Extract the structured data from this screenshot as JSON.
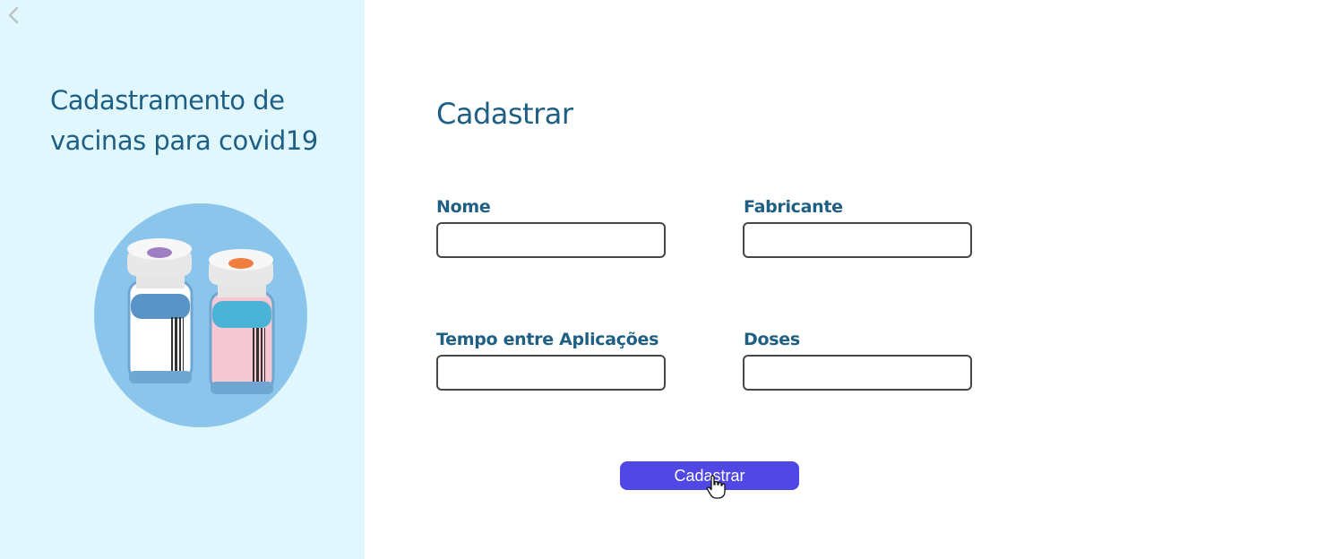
{
  "sidebar": {
    "title": "Cadastramento de vacinas para covid19",
    "back_icon": "chevron-left-icon",
    "background": "#e0f7fe"
  },
  "form": {
    "title": "Cadastrar",
    "fields": [
      {
        "label": "Nome",
        "value": "",
        "placeholder": ""
      },
      {
        "label": "Fabricante",
        "value": "",
        "placeholder": ""
      },
      {
        "label": "Tempo entre Aplicações",
        "value": "",
        "placeholder": ""
      },
      {
        "label": "Doses",
        "value": "",
        "placeholder": ""
      }
    ],
    "submit_label": "Cadastrar"
  },
  "colors": {
    "heading": "#1f5f83",
    "button": "#5047e5",
    "sidebar_bg": "#e0f7fe"
  }
}
